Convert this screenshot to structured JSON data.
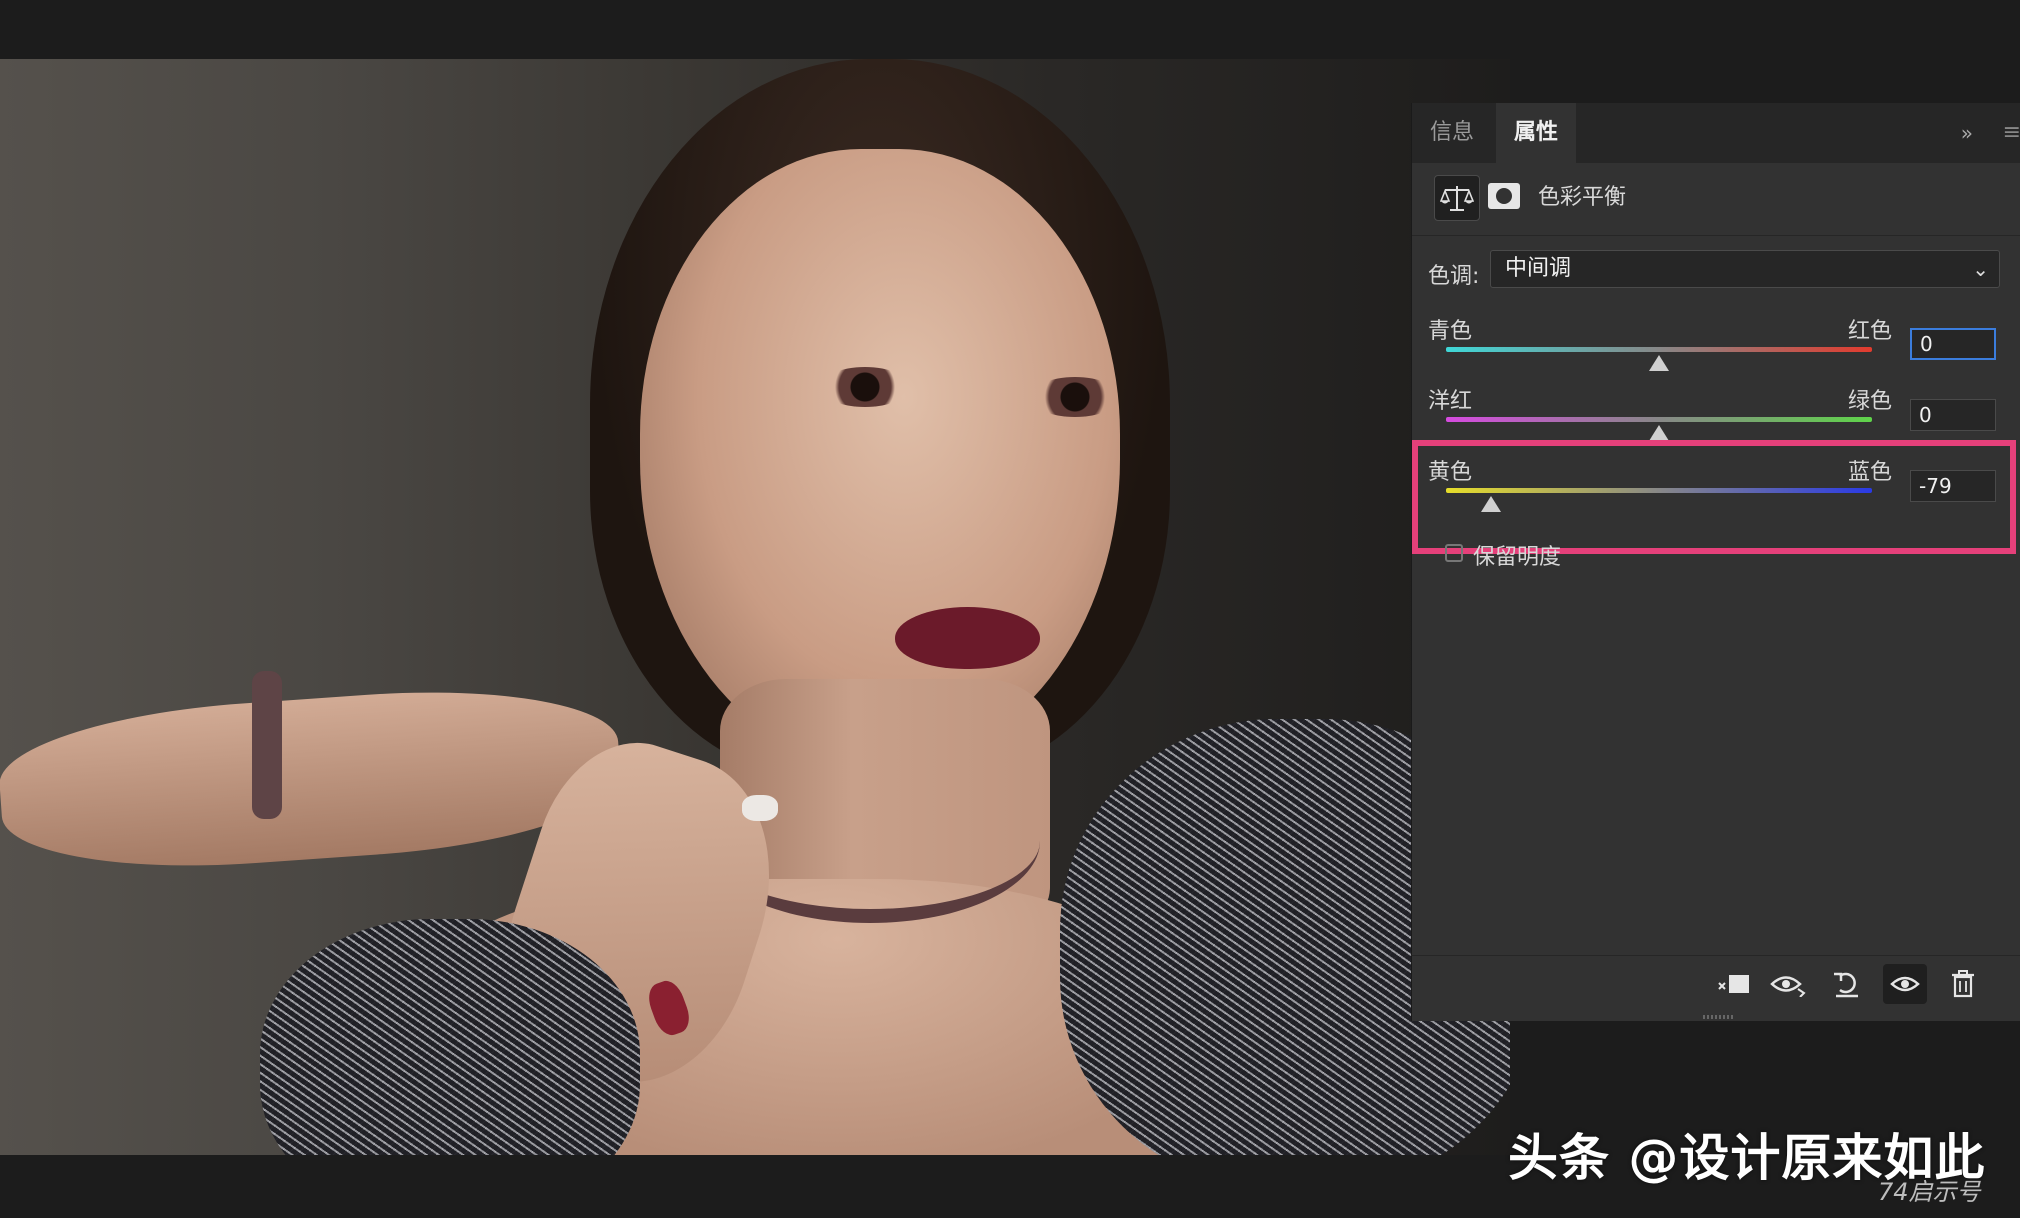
{
  "tabs": [
    {
      "label": "信息",
      "active": false
    },
    {
      "label": "属性",
      "active": true
    }
  ],
  "panel_controls": {
    "collapse_glyph": "»",
    "menu_glyph": "≡"
  },
  "adjustment": {
    "title": "色彩平衡",
    "icon": "scales-icon",
    "mask_icon": "layer-mask-icon"
  },
  "tone": {
    "label": "色调:",
    "value": "中间调"
  },
  "sliders": [
    {
      "left": "青色",
      "right": "红色",
      "value": "0",
      "level": 0,
      "range": [
        -100,
        100
      ],
      "focused": true
    },
    {
      "left": "洋红",
      "right": "绿色",
      "value": "0",
      "level": 0,
      "range": [
        -100,
        100
      ],
      "focused": false
    },
    {
      "left": "黄色",
      "right": "蓝色",
      "value": "-79",
      "level": -79,
      "range": [
        -100,
        100
      ],
      "focused": false,
      "highlighted": true
    }
  ],
  "preserve_luminosity": {
    "label": "保留明度",
    "checked": false
  },
  "bottom_icons": [
    "clip-to-layer-icon",
    "view-previous-state-icon",
    "reset-icon",
    "visibility-eye-icon",
    "trash-icon"
  ],
  "watermark": {
    "main": "头条 @设计原来如此",
    "corner": "74启示号"
  },
  "colors": {
    "highlight": "#e5407a",
    "focus": "#3b7ddd",
    "panel": "#323232"
  }
}
